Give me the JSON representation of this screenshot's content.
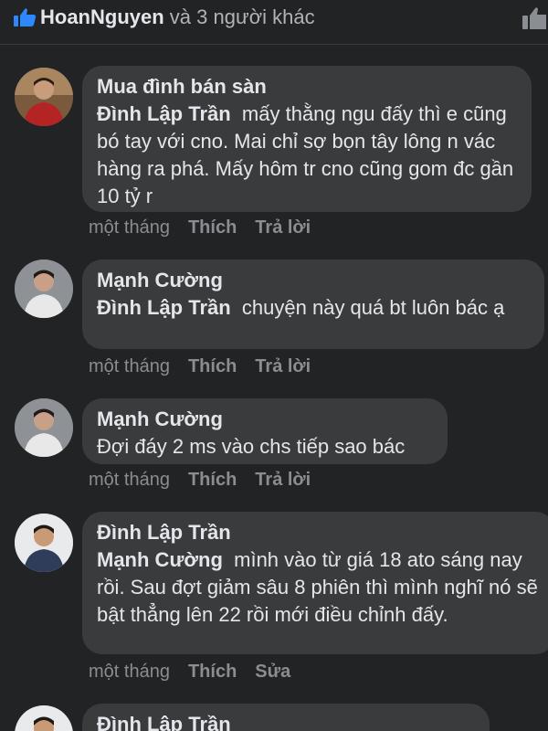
{
  "header": {
    "reactor_name": "HoanNguyen",
    "reactor_suffix": " và 3 người khác",
    "like_color": "#2d88ff"
  },
  "comments": [
    {
      "author": "Mua đình bán sàn",
      "mention": "Đình Lập Trần",
      "text": "mấy thằng ngu đấy thì e cũng bó tay với cno. Mai chỉ sợ bọn tây lông n vác hàng ra phá. Mấy hôm tr cno cũng gom đc gần 10 tỷ r",
      "time": "một tháng",
      "like_label": "Thích",
      "reply_label": "Trả lời"
    },
    {
      "author": "Mạnh Cường",
      "mention": "Đình Lập Trần",
      "text": "chuyện này quá bt luôn bác ạ",
      "time": "một tháng",
      "like_label": "Thích",
      "reply_label": "Trả lời"
    },
    {
      "author": "Mạnh Cường",
      "mention": "",
      "text": "Đợi đáy 2 ms vào chs tiếp sao bác",
      "time": "một tháng",
      "like_label": "Thích",
      "reply_label": "Trả lời"
    },
    {
      "author": "Đình Lập Trần",
      "mention": "Mạnh Cường",
      "text": "mình vào từ giá 18 ato sáng nay rồi. Sau đợt giảm sâu 8 phiên thì mình nghĩ nó sẽ bật thẳng lên 22 rồi mới điều chỉnh đấy.",
      "time": "một tháng",
      "like_label": "Thích",
      "reply_label": "Sửa"
    },
    {
      "author": "Đình Lập Trần"
    }
  ]
}
